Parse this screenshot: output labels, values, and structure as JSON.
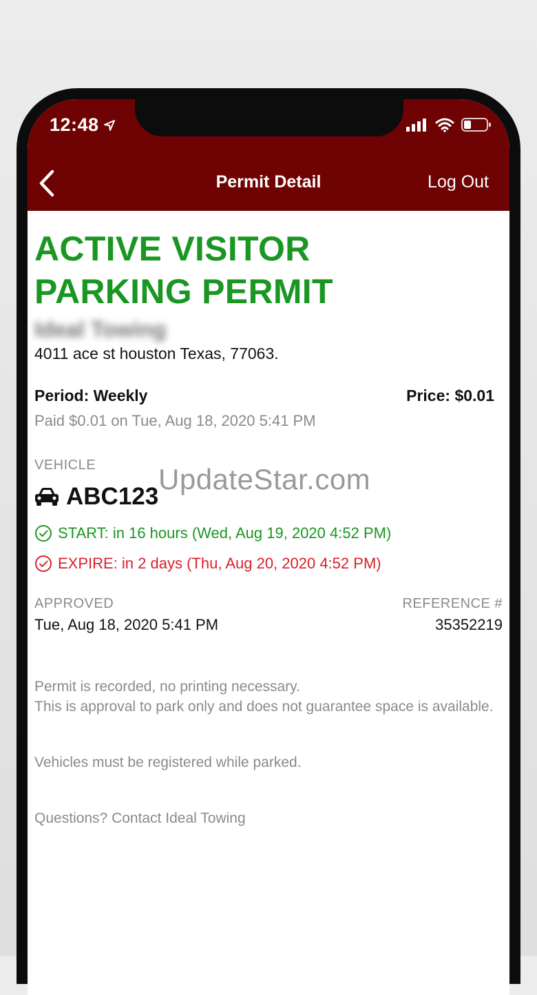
{
  "status_bar": {
    "time": "12:48"
  },
  "nav": {
    "title": "Permit Detail",
    "logout_label": "Log Out"
  },
  "permit": {
    "headline_line1": "ACTIVE VISITOR",
    "headline_line2": "PARKING PERMIT",
    "company_blurred": "Ideal Towing",
    "address": "4011 ace st houston Texas, 77063.",
    "period": "Period: Weekly",
    "price": "Price: $0.01",
    "paid": "Paid $0.01 on Tue, Aug 18, 2020 5:41 PM",
    "vehicle_label": "VEHICLE",
    "plate": "ABC123",
    "start": "START: in 16 hours (Wed, Aug 19, 2020 4:52 PM)",
    "expire": "EXPIRE:  in 2 days (Thu, Aug 20, 2020 4:52 PM)",
    "approved_label": "APPROVED",
    "approved_value": "Tue, Aug 18, 2020 5:41 PM",
    "reference_label": "REFERENCE #",
    "reference_value": "35352219"
  },
  "notes": {
    "line1": "Permit is recorded, no printing necessary.",
    "line2": "This is approval to park only and does not guarantee space is available.",
    "line3": "Vehicles must be registered while parked.",
    "line4": "Questions? Contact Ideal Towing"
  },
  "watermark": "UpdateStar.com",
  "colors": {
    "header_bg": "#6f0303",
    "active_green": "#1a9622",
    "expire_red": "#d8202a",
    "muted_gray": "#8a8a8a"
  },
  "icons": [
    "location-arrow-icon",
    "signal-icon",
    "wifi-icon",
    "battery-icon",
    "back-chevron-icon",
    "car-icon",
    "check-circle-icon",
    "check-circle-icon"
  ]
}
